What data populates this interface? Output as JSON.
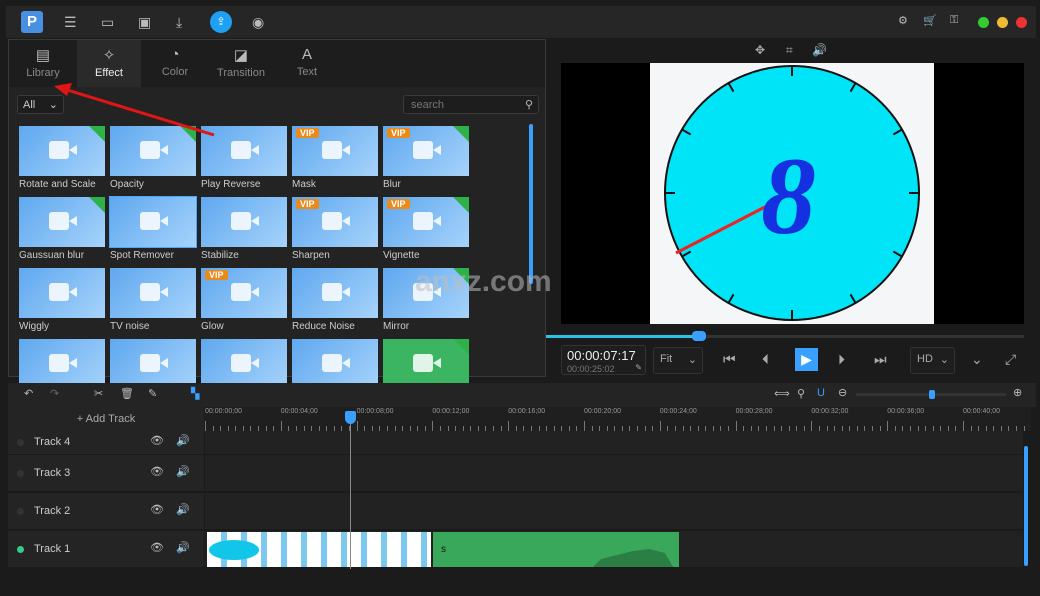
{
  "toolbar": {
    "icons": [
      "app-logo",
      "menu-icon",
      "new-icon",
      "save-icon",
      "import-icon",
      "export-icon",
      "record-icon"
    ],
    "right_icons": [
      "settings-icon",
      "cart-icon",
      "key-icon"
    ]
  },
  "tabs": [
    {
      "label": "Library",
      "icon": "library-icon"
    },
    {
      "label": "Effect",
      "icon": "magic-wand-icon"
    },
    {
      "label": "Color",
      "icon": "palette-icon"
    },
    {
      "label": "Transition",
      "icon": "transition-icon"
    },
    {
      "label": "Text",
      "icon": "text-icon"
    }
  ],
  "active_tab": "Effect",
  "filter": {
    "value": "All"
  },
  "search": {
    "placeholder": "search"
  },
  "effects": [
    {
      "label": "Rotate and Scale",
      "vip": false,
      "power": true
    },
    {
      "label": "Opacity",
      "vip": false,
      "power": true
    },
    {
      "label": "Play Reverse",
      "vip": false,
      "power": false
    },
    {
      "label": "Mask",
      "vip": true,
      "power": false
    },
    {
      "label": "Blur",
      "vip": true,
      "power": true
    },
    {
      "label": "Gaussuan blur",
      "vip": false,
      "power": true
    },
    {
      "label": "Spot Remover",
      "vip": false,
      "power": false,
      "selected": true
    },
    {
      "label": "Stabilize",
      "vip": false,
      "power": false
    },
    {
      "label": "Sharpen",
      "vip": true,
      "power": false
    },
    {
      "label": "Vignette",
      "vip": true,
      "power": true
    },
    {
      "label": "Wiggly",
      "vip": false,
      "power": false
    },
    {
      "label": "TV noise",
      "vip": false,
      "power": false
    },
    {
      "label": "Glow",
      "vip": true,
      "power": false
    },
    {
      "label": "Reduce Noise",
      "vip": false,
      "power": false
    },
    {
      "label": "Mirror",
      "vip": false,
      "power": true
    },
    {
      "label": "",
      "vip": false,
      "power": false
    },
    {
      "label": "",
      "vip": false,
      "power": false
    },
    {
      "label": "",
      "vip": false,
      "power": false
    },
    {
      "label": "",
      "vip": false,
      "power": false
    },
    {
      "label": "",
      "vip": false,
      "power": true
    }
  ],
  "vip_label": "VIP",
  "player": {
    "current_time": "00:00:07:17",
    "total_time": "00:00:25:02",
    "zoom": "Fit",
    "quality": "HD",
    "progress": 0.3,
    "clock_digit": "8"
  },
  "timeline": {
    "add_track": "+ Add Track",
    "ticks": [
      "00:00:00;00",
      "00:00:04;00",
      "00:00:08;00",
      "00:00:12;00",
      "00:00:16;00",
      "00:00:20;00",
      "00:00:24;00",
      "00:00:28;00",
      "00:00:32;00",
      "00:00:36;00",
      "00:00:40;00"
    ],
    "tracks": [
      "Track 4",
      "Track 3",
      "Track 2",
      "Track 1"
    ],
    "audio_clip_label": "s",
    "zoom_level": 0.33
  },
  "watermark": "anxz.com"
}
